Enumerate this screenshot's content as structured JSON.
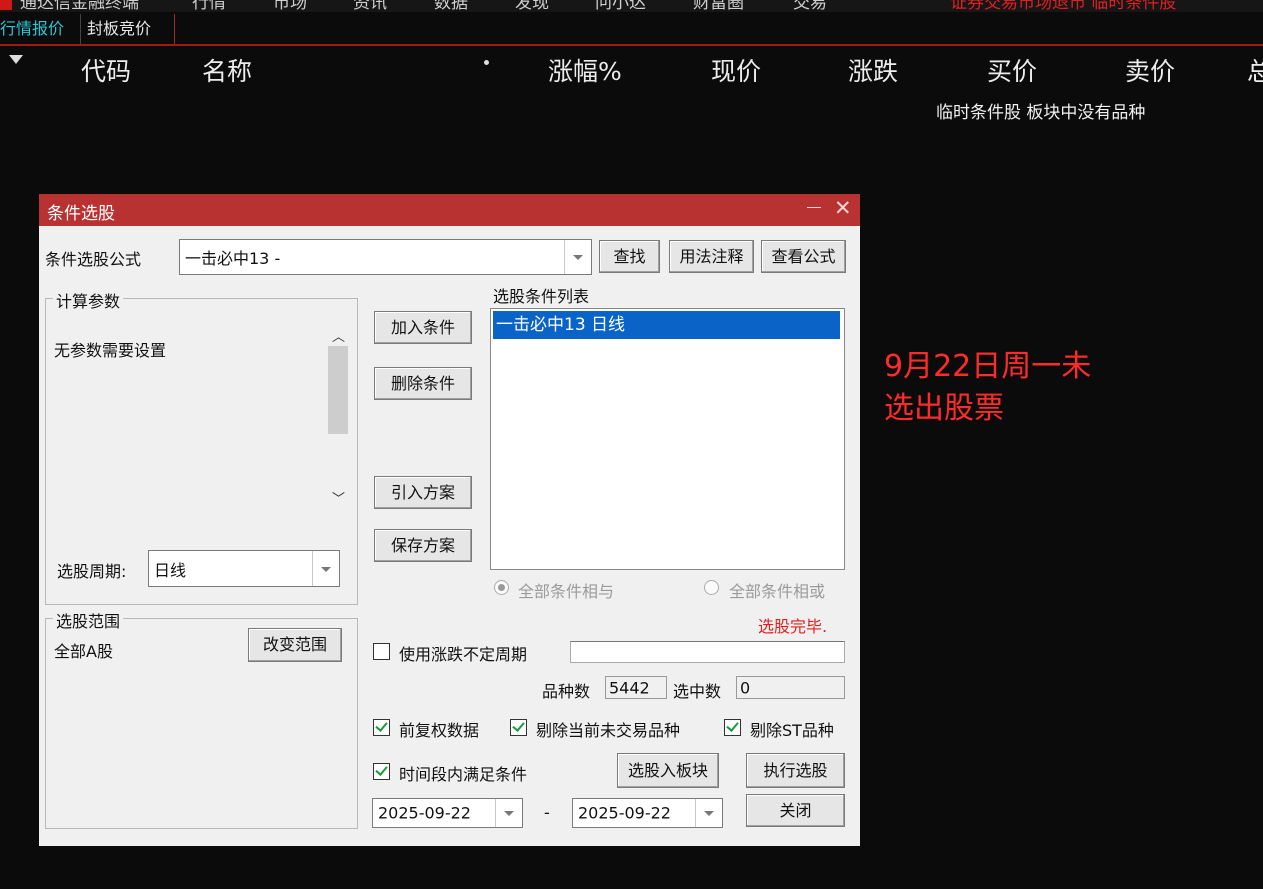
{
  "top_menu": {
    "items": [
      "通达信金融终端",
      "行情",
      "市场",
      "资讯",
      "数据",
      "发现",
      "问小达",
      "财富圈",
      "交易"
    ],
    "notice": "证券交易市场退市 临时条件股"
  },
  "tabs": [
    "行情报价",
    "封板竞价"
  ],
  "columns": [
    "代码",
    "名称",
    "涨幅%",
    "现价",
    "涨跌",
    "买价",
    "卖价",
    "总"
  ],
  "empty_message": "临时条件股 板块中没有品种",
  "annotation": {
    "line1": "9月22日周一未",
    "line2": "选出股票"
  },
  "dialog": {
    "title": "条件选股",
    "formula_label": "条件选股公式",
    "formula_value": "一击必中13  -",
    "btn_find": "查找",
    "btn_usage": "用法注释",
    "btn_view": "查看公式",
    "params_group": "计算参数",
    "params_text": "无参数需要设置",
    "period_label": "选股周期:",
    "period_value": "日线",
    "range_group": "选股范围",
    "range_value": "全部A股",
    "btn_change_range": "改变范围",
    "btn_add": "加入条件",
    "btn_delete": "删除条件",
    "btn_import": "引入方案",
    "btn_save": "保存方案",
    "list_label": "选股条件列表",
    "list_items": [
      "一击必中13  日线"
    ],
    "radio_and": "全部条件相与",
    "radio_or": "全部条件相或",
    "status": "选股完毕.",
    "cb_variable_period": "使用涨跌不定周期",
    "count_label": "品种数",
    "count_value": "5442",
    "selected_label": "选中数",
    "selected_value": "0",
    "cb_forward_adjust": "前复权数据",
    "cb_exclude_untraded": "剔除当前未交易品种",
    "cb_exclude_st": "剔除ST品种",
    "cb_period_satisfy": "时间段内满足条件",
    "btn_to_block": "选股入板块",
    "btn_execute": "执行选股",
    "date_from": "2025-09-22",
    "date_dash": "-",
    "date_to": "2025-09-22",
    "btn_close": "关闭"
  },
  "colors": {
    "accent_red": "#b83232",
    "tab_active": "#29c7d9",
    "annotation": "#ff2a2a",
    "status_red": "#e02020"
  }
}
